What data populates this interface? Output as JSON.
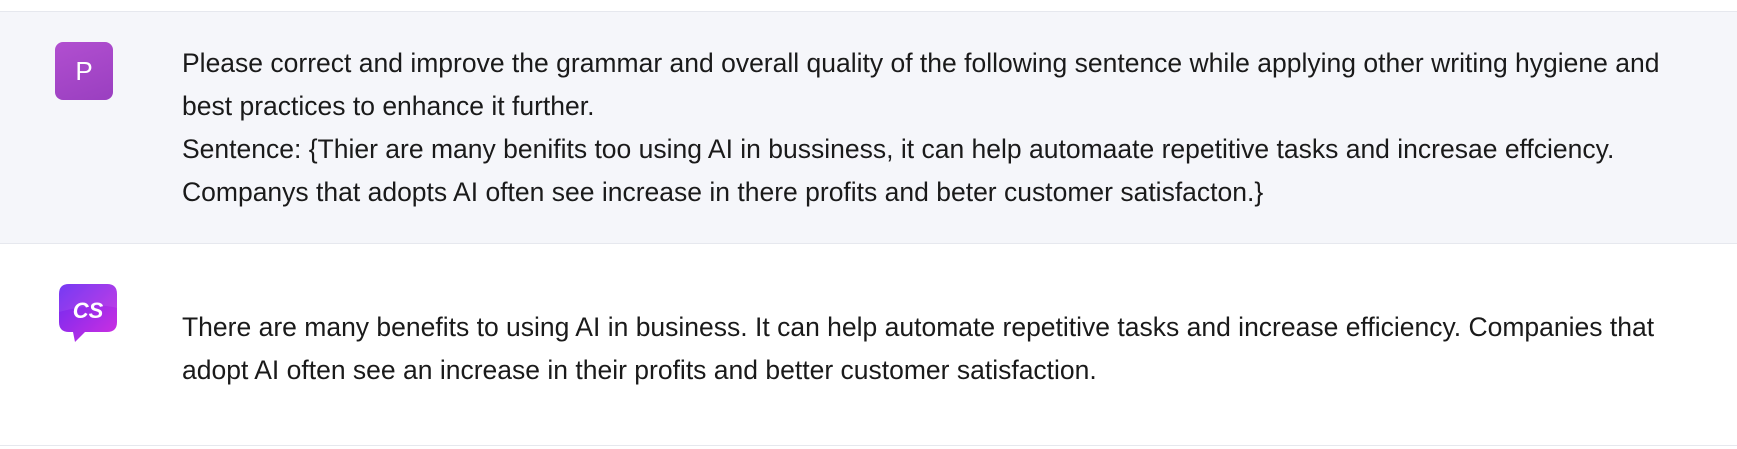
{
  "conversation": {
    "user_message": {
      "avatar_letter": "P",
      "avatar_color": "#a846c8",
      "lines": [
        "Please correct and improve the grammar and overall quality of the following sentence while applying other writing hygiene and best practices to enhance it further.",
        "Sentence: {Thier are many benifits too using AI in bussiness, it can help automaate repetitive tasks and incresae effciency. Companys that adopts AI often see increase in there profits and beter customer satisfacton.}"
      ]
    },
    "assistant_message": {
      "avatar_label": "CS",
      "avatar_icon": "copysmith-logo-icon",
      "avatar_colors": [
        "#7b2cf5",
        "#c42ee0"
      ],
      "text": "There are many benefits to using AI in business. It can help automate repetitive tasks and increase efficiency. Companies that adopt AI often see an increase in their profits and better customer satisfaction."
    }
  },
  "colors": {
    "user_bg": "#f5f6fa",
    "assistant_bg": "#ffffff",
    "divider": "#e6e8ee",
    "text": "#1a1a1a"
  }
}
